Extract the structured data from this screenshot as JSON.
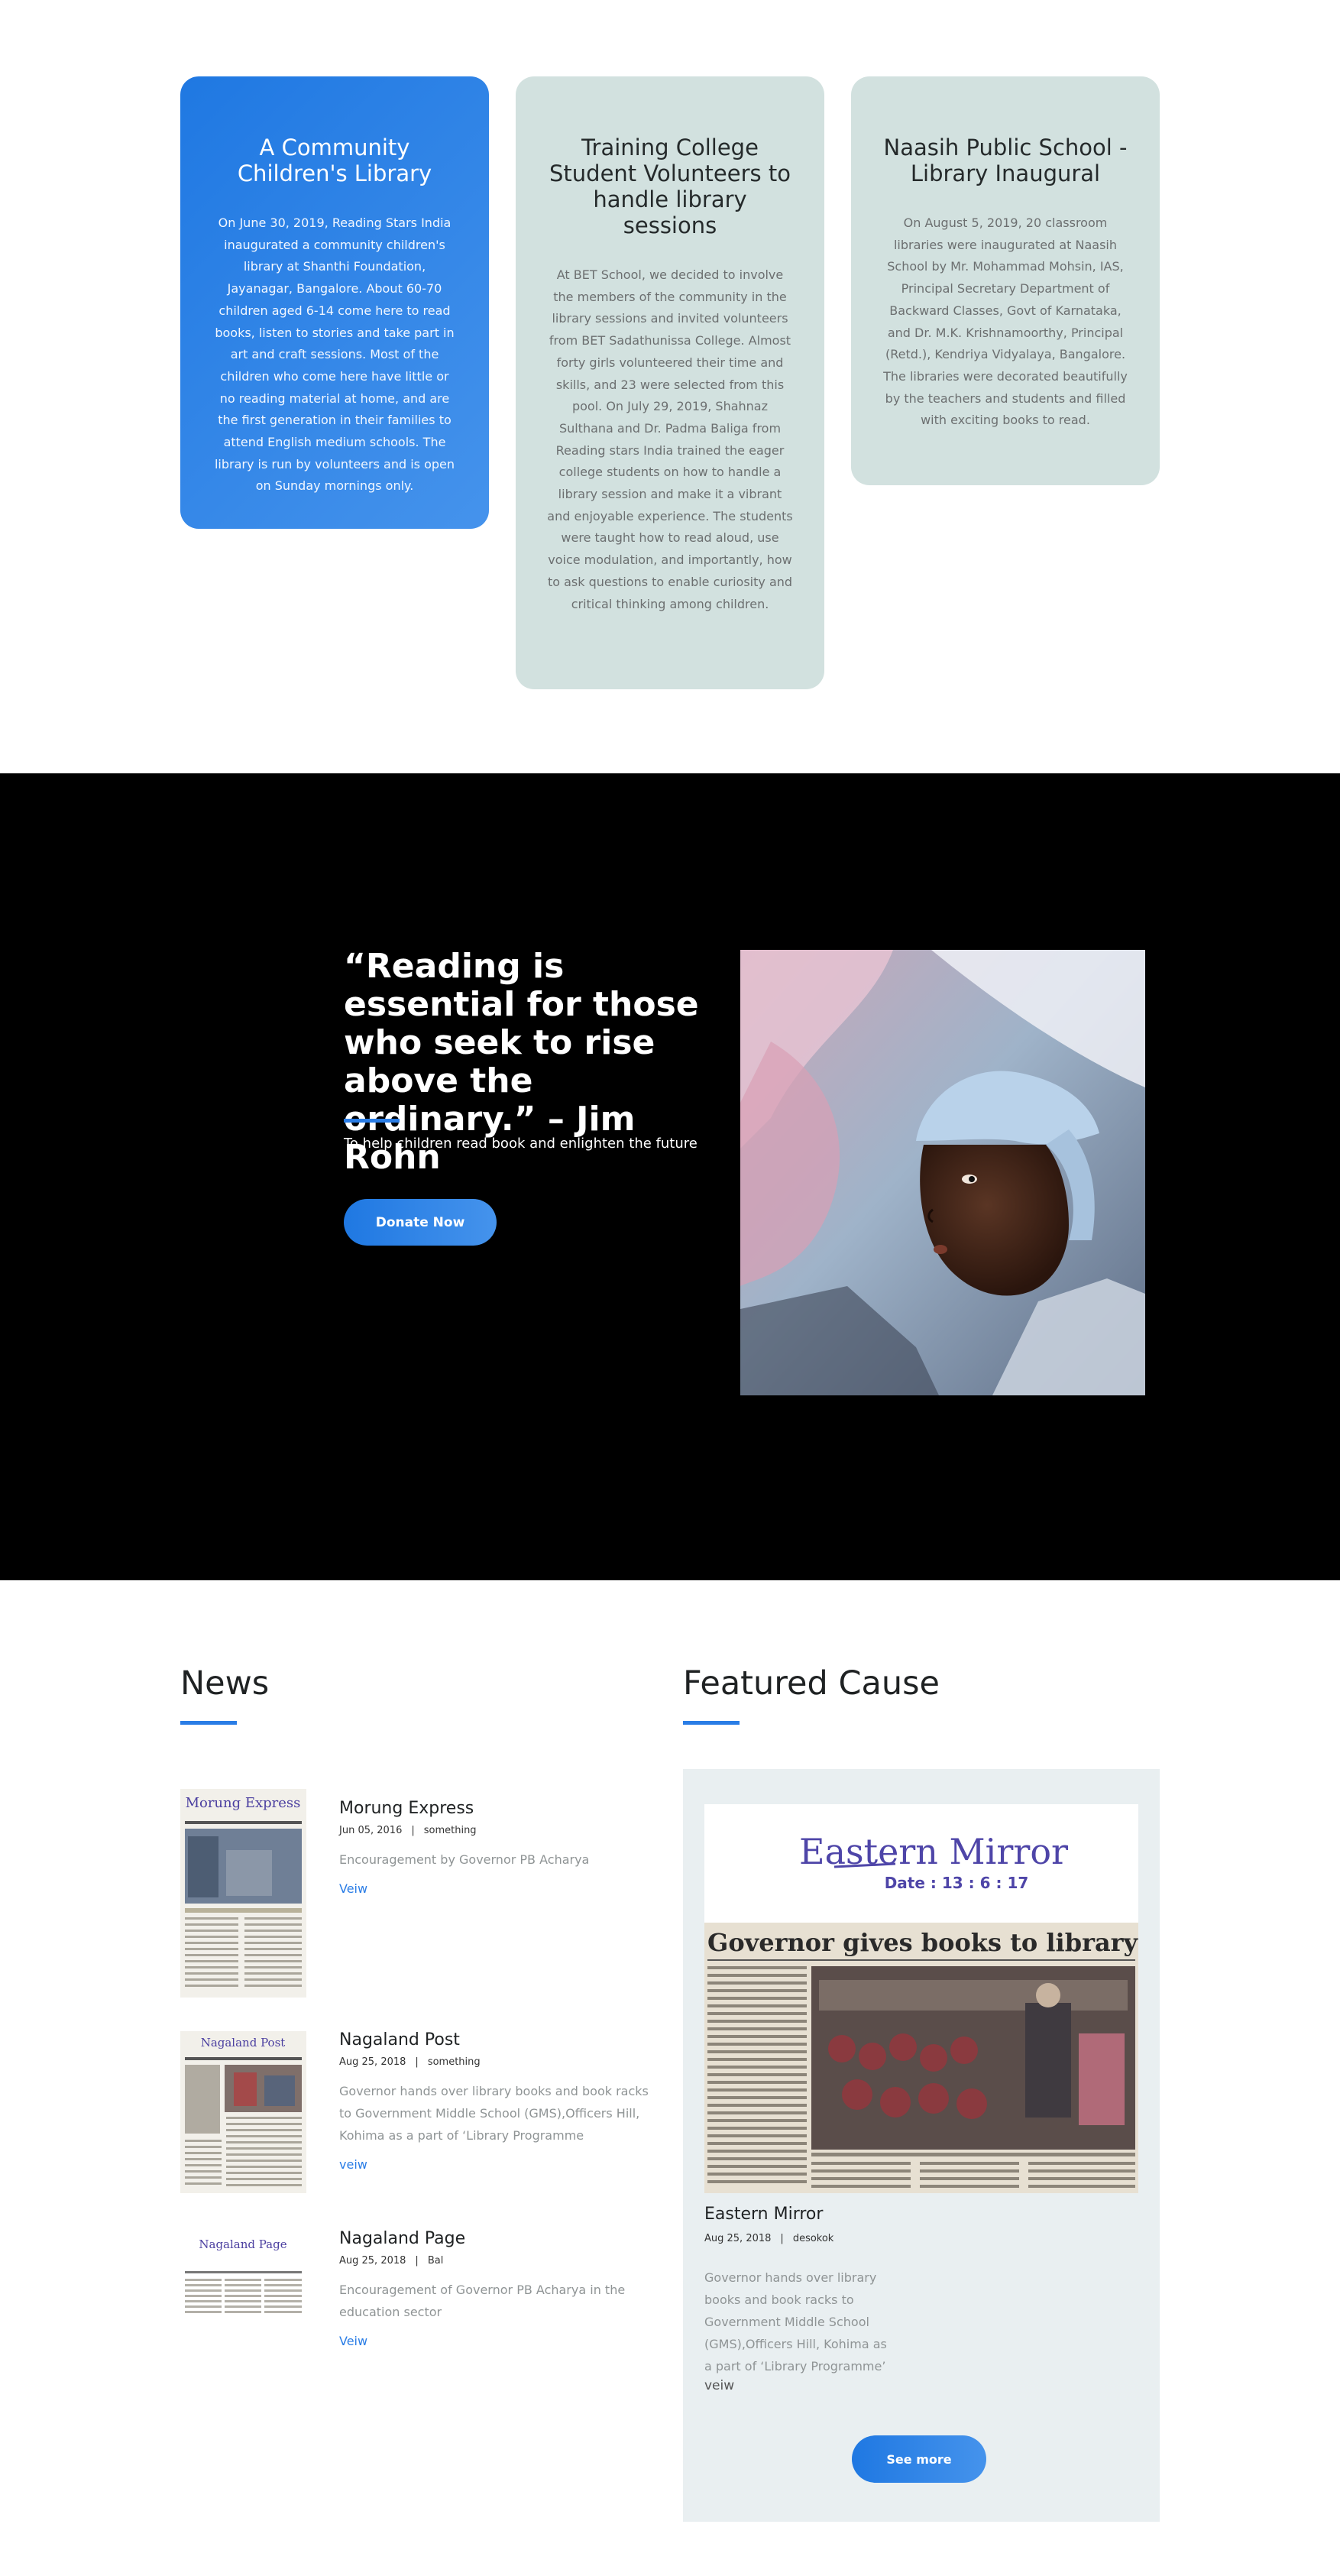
{
  "cards": [
    {
      "title": "A Community Children's Library",
      "body": "On June 30, 2019, Reading Stars India inaugurated a community children's library at Shanthi Foundation, Jayanagar, Bangalore. About 60-70 children aged 6-14 come here to read books, listen to stories and take part in art and craft sessions. Most of the children who come here have little or no reading material at home, and are the first generation in their families to attend English medium schools. The library is run by volunteers and is open on Sunday mornings only."
    },
    {
      "title": "Training College Student Volunteers to handle library sessions",
      "body": "At BET School, we decided to involve the members of the community in the library sessions and invited volunteers from BET Sadathunissa College. Almost forty girls volunteered their time and skills, and 23 were selected from this pool. On July 29, 2019, Shahnaz Sulthana and Dr. Padma Baliga from Reading stars India trained the eager college students on how to handle a library session and make it a vibrant and enjoyable experience. The students were taught how to read aloud, use voice modulation, and importantly, how to ask questions to enable curiosity and critical thinking among children."
    },
    {
      "title": "Naasih Public School - Library Inaugural",
      "body": "On August 5, 2019, 20 classroom libraries were inaugurated at Naasih School by Mr. Mohammad Mohsin, IAS, Principal Secretary Department of Backward Classes, Govt of Karnataka, and Dr. M.K. Krishnamoorthy, Principal (Retd.), Kendriya Vidyalaya, Bangalore. The libraries were decorated beautifully by the teachers and students and filled with exciting books to read."
    }
  ],
  "quote": {
    "text": "“Reading is essential for those who seek to rise above the ordinary.” – Jim Rohn",
    "subtitle": "To help children read book and enlighten the future",
    "button": "Donate Now"
  },
  "news": {
    "title": "News",
    "items": [
      {
        "title": "Morung Express",
        "date": "Jun 05, 2016",
        "sep": "|",
        "tag": "something",
        "desc": "Encouragement by Governor PB Acharya",
        "link": "Veiw",
        "paper_name": "Morung Express"
      },
      {
        "title": "Nagaland Post",
        "date": "Aug 25, 2018",
        "sep": "|",
        "tag": "something",
        "desc": "Governor hands over library books and book racks to Government Middle School (GMS),Officers Hill, Kohima as a part of ‘Library Programme",
        "link": "veiw",
        "paper_name": "Nagaland Post"
      },
      {
        "title": "Nagaland Page",
        "date": "Aug 25, 2018",
        "sep": "|",
        "tag": "Bal",
        "desc": "Encouragement of Governor PB Acharya in the education sector",
        "link": "Veiw",
        "paper_name": "Nagaland Page"
      }
    ]
  },
  "featured": {
    "title": "Featured Cause",
    "item_title": "Eastern Mirror",
    "date": "Aug 25, 2018",
    "sep": "|",
    "tag": "desokok",
    "desc": "Governor hands over library books and book racks to Government Middle School (GMS),Officers Hill, Kohima as a part of ‘Library Programme’",
    "link": "veiw",
    "button": "See more",
    "paper_masthead": "Eastern Mirror",
    "paper_date": "Date : 13 : 6 : 17",
    "paper_headline": "Governor gives books to library"
  },
  "colors": {
    "accent": "#2a7de6",
    "card_blue": "#1f78e2",
    "card_grey": "#d2e1df",
    "featured_bg": "#e9eff1"
  }
}
